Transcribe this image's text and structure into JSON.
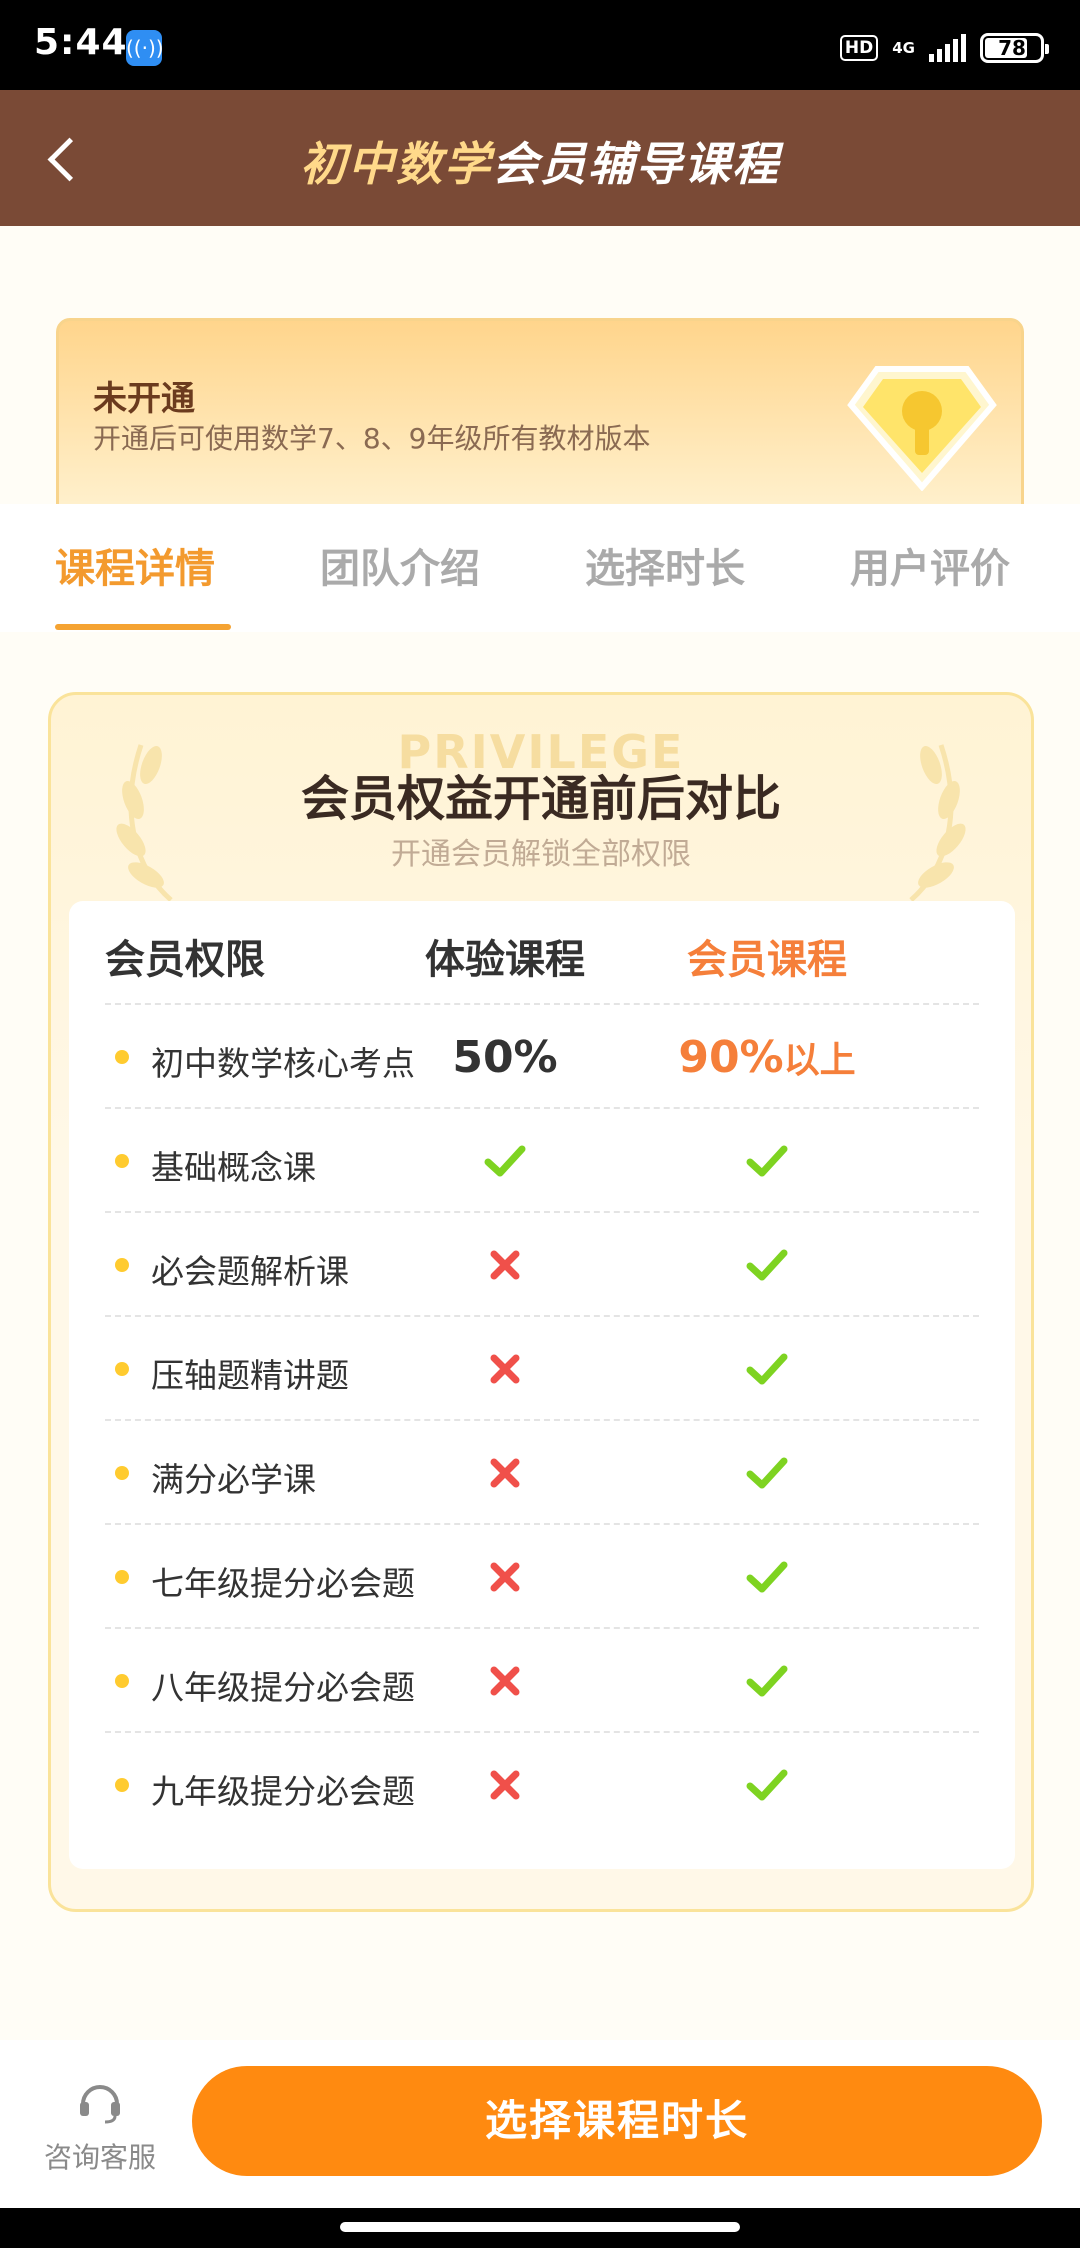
{
  "status_bar": {
    "time": "5:44",
    "hd": "HD",
    "network": "4G",
    "battery": "78",
    "battery_level": 0.78
  },
  "header": {
    "title_highlight": "初中数学",
    "title_rest": "会员辅导课程"
  },
  "membership": {
    "status": "未开通",
    "description": "开通后可使用数学7、8、9年级所有教材版本"
  },
  "tabs": [
    {
      "label": "课程详情",
      "active": true
    },
    {
      "label": "团队介绍",
      "active": false
    },
    {
      "label": "选择时长",
      "active": false
    },
    {
      "label": "用户评价",
      "active": false
    }
  ],
  "comparison": {
    "watermark": "PRIVILEGE",
    "title": "会员权益开通前后对比",
    "subtitle": "开通会员解锁全部权限",
    "headers": [
      "会员权限",
      "体验课程",
      "会员课程"
    ],
    "first_row": {
      "feature": "初中数学核心考点",
      "trial_value": "50%",
      "member_value": "90%",
      "member_suffix": "以上"
    },
    "rows": [
      {
        "feature": "基础概念课",
        "trial": "check",
        "member": "check"
      },
      {
        "feature": "必会题解析课",
        "trial": "cross",
        "member": "check"
      },
      {
        "feature": "压轴题精讲题",
        "trial": "cross",
        "member": "check"
      },
      {
        "feature": "满分必学课",
        "trial": "cross",
        "member": "check"
      },
      {
        "feature": "七年级提分必会题",
        "trial": "cross",
        "member": "check"
      },
      {
        "feature": "八年级提分必会题",
        "trial": "cross",
        "member": "check"
      },
      {
        "feature": "九年级提分必会题",
        "trial": "cross",
        "member": "check"
      }
    ]
  },
  "bottom": {
    "service_label": "咨询客服",
    "cta_label": "选择课程时长"
  },
  "colors": {
    "header_bg": "#7a4a36",
    "accent_orange": "#ff8a10",
    "tab_active": "#f39a2e",
    "check_green": "#7ed321",
    "cross_red": "#f0504a"
  }
}
